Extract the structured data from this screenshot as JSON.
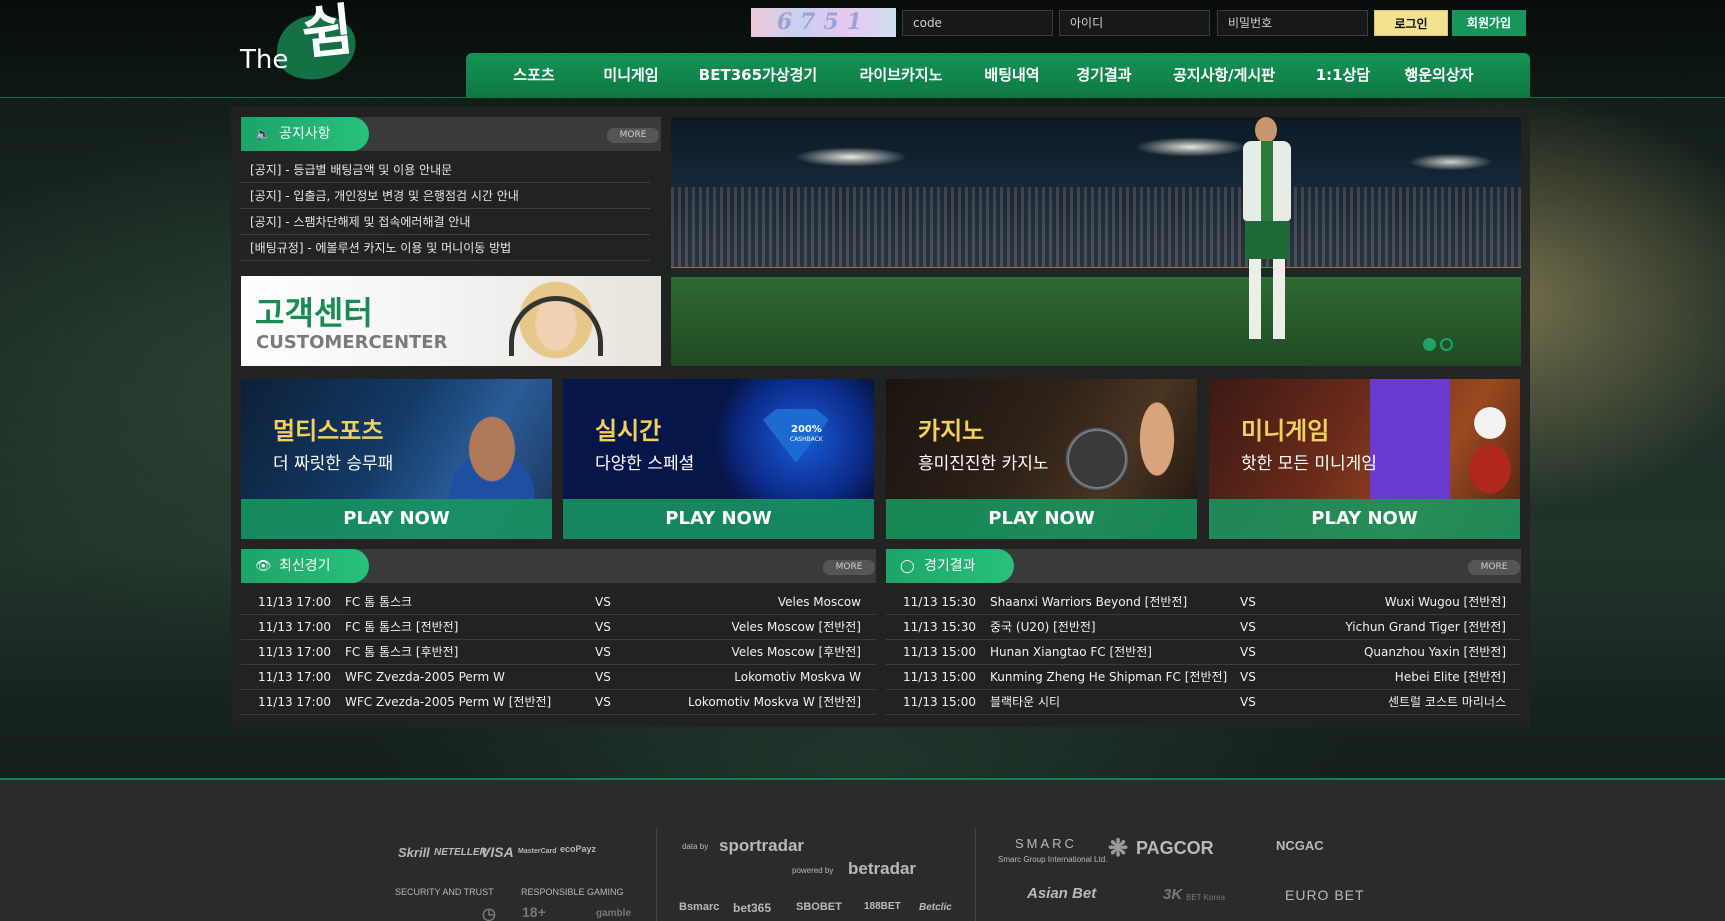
{
  "header": {
    "logo_prefix": "The",
    "logo_main": "쉼",
    "captcha_text": "6751",
    "code_placeholder": "code",
    "id_placeholder": "아이디",
    "password_placeholder": "비밀번호",
    "login_label": "로그인",
    "join_label": "회원가입"
  },
  "nav": [
    "스포츠",
    "미니게임",
    "BET365가상경기",
    "라이브카지노",
    "배팅내역",
    "경기결과",
    "공지사항/게시판",
    "1:1상담",
    "행운의상자"
  ],
  "notice": {
    "title": "공지사항",
    "more": "MORE",
    "items": [
      "[공지] - 등급별 배팅금액 및 이용 안내문",
      "[공지] - 입출금, 개인정보 변경 및 은행점검 시간 안내",
      "[공지] - 스팸차단해제 및 접속에러해결 안내",
      "[배팅규정] - 에볼루션 카지노 이용 및 머니이동 방법"
    ]
  },
  "customer_center": {
    "korean": "고객센터",
    "english": "CUSTOMERCENTER"
  },
  "cards": [
    {
      "title": "멀티스포츠",
      "sub": "더 짜릿한 승무패",
      "cta": "PLAY NOW"
    },
    {
      "title": "실시간",
      "sub": "다양한 스페셜",
      "cta": "PLAY NOW",
      "badge": "200%",
      "badge_sub": "CASHBACK"
    },
    {
      "title": "카지노",
      "sub": "흥미진진한 카지노",
      "cta": "PLAY NOW"
    },
    {
      "title": "미니게임",
      "sub": "핫한 모든 미니게임",
      "cta": "PLAY NOW"
    }
  ],
  "latest_games": {
    "title": "최신경기",
    "more": "MORE",
    "rows": [
      {
        "datetime": "11/13 17:00",
        "home": "FC 톰 톰스크",
        "vs": "VS",
        "away": "Veles Moscow"
      },
      {
        "datetime": "11/13 17:00",
        "home": "FC 톰 톰스크 [전반전]",
        "vs": "VS",
        "away": "Veles Moscow [전반전]"
      },
      {
        "datetime": "11/13 17:00",
        "home": "FC 톰 톰스크 [후반전]",
        "vs": "VS",
        "away": "Veles Moscow [후반전]"
      },
      {
        "datetime": "11/13 17:00",
        "home": "WFC Zvezda-2005 Perm W",
        "vs": "VS",
        "away": "Lokomotiv Moskva W"
      },
      {
        "datetime": "11/13 17:00",
        "home": "WFC Zvezda-2005 Perm W [전반전]",
        "vs": "VS",
        "away": "Lokomotiv Moskva W [전반전]"
      }
    ]
  },
  "results": {
    "title": "경기결과",
    "more": "MORE",
    "rows": [
      {
        "datetime": "11/13 15:30",
        "home": "Shaanxi Warriors Beyond [전반전]",
        "vs": "VS",
        "away": "Wuxi Wugou [전반전]"
      },
      {
        "datetime": "11/13 15:30",
        "home": "중국 (U20) [전반전]",
        "vs": "VS",
        "away": "Yichun Grand Tiger [전반전]"
      },
      {
        "datetime": "11/13 15:00",
        "home": "Hunan Xiangtao FC [전반전]",
        "vs": "VS",
        "away": "Quanzhou Yaxin [전반전]"
      },
      {
        "datetime": "11/13 15:00",
        "home": "Kunming Zheng He Shipman FC [전반전]",
        "vs": "VS",
        "away": "Hebei Elite [전반전]"
      },
      {
        "datetime": "11/13 15:00",
        "home": "블랙타운 시티",
        "vs": "VS",
        "away": "센트럴 코스트 마리너스"
      }
    ]
  },
  "footer": {
    "payments": [
      "Skrill",
      "NETELLER",
      "VISA",
      "MasterCard",
      "ecoPayz"
    ],
    "security_label": "SECURITY AND TRUST",
    "responsible_label": "RESPONSIBLE GAMING",
    "age_label": "18+",
    "gamble_label": "gamble",
    "data_by": "data by",
    "sportradar": "sportradar",
    "powered_by": "powered by",
    "betradar": "betradar",
    "providers": [
      "Bsmarc",
      "bet365",
      "SBOBET",
      "188BET",
      "Betclic"
    ],
    "regulators": [
      "SMARC",
      "PAGCOR",
      "NCGAC"
    ],
    "smarc_sub": "Smarc Group International Ltd.",
    "brands": [
      "Asian Bet",
      "3K",
      "EURO BET"
    ],
    "betkorea_label": "BET Korea"
  },
  "colors": {
    "accent_green": "#17955a",
    "gold_title": "#f1d05c",
    "login_yellow": "#f2e18f"
  }
}
